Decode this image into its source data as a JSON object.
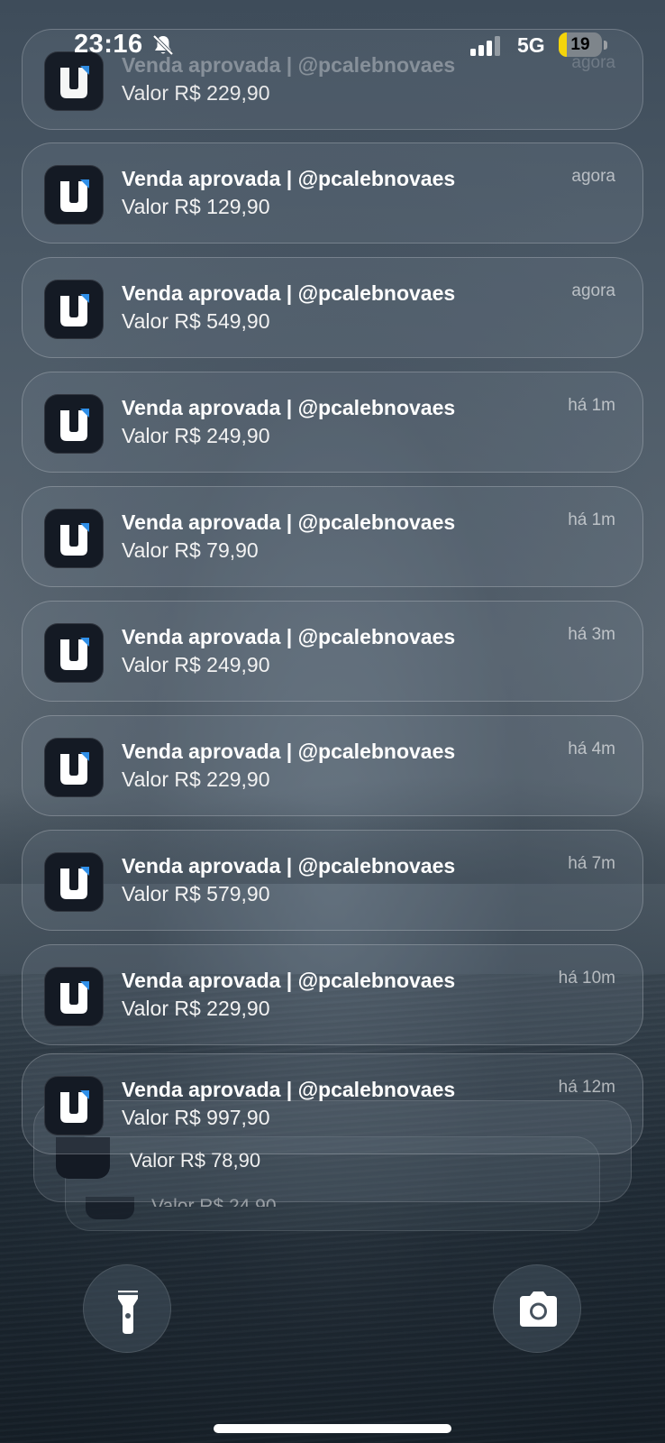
{
  "status_bar": {
    "time": "23:16",
    "silent_icon": "bell-slash-icon",
    "signal_icon": "cellular-signal-icon",
    "network": "5G",
    "battery_level": "19",
    "battery_fraction": 0.19,
    "battery_color": "#f4d40a"
  },
  "notifications": [
    {
      "title": "Venda aprovada | @pcalebnovaes",
      "body": "Valor R$ 229,90",
      "time": "agora",
      "icon": "app-logo-icon"
    },
    {
      "title": "Venda aprovada | @pcalebnovaes",
      "body": "Valor R$ 129,90",
      "time": "agora",
      "icon": "app-logo-icon"
    },
    {
      "title": "Venda aprovada | @pcalebnovaes",
      "body": "Valor R$ 549,90",
      "time": "agora",
      "icon": "app-logo-icon"
    },
    {
      "title": "Venda aprovada | @pcalebnovaes",
      "body": "Valor R$ 249,90",
      "time": "há 1m",
      "icon": "app-logo-icon"
    },
    {
      "title": "Venda aprovada | @pcalebnovaes",
      "body": "Valor R$ 79,90",
      "time": "há 1m",
      "icon": "app-logo-icon"
    },
    {
      "title": "Venda aprovada | @pcalebnovaes",
      "body": "Valor R$ 249,90",
      "time": "há 3m",
      "icon": "app-logo-icon"
    },
    {
      "title": "Venda aprovada | @pcalebnovaes",
      "body": "Valor R$ 229,90",
      "time": "há 4m",
      "icon": "app-logo-icon"
    },
    {
      "title": "Venda aprovada | @pcalebnovaes",
      "body": "Valor R$ 579,90",
      "time": "há 7m",
      "icon": "app-logo-icon"
    },
    {
      "title": "Venda aprovada | @pcalebnovaes",
      "body": "Valor R$ 229,90",
      "time": "há 10m",
      "icon": "app-logo-icon"
    },
    {
      "title": "Venda aprovada | @pcalebnovaes",
      "body": "Valor R$ 997,90",
      "time": "há 12m",
      "icon": "app-logo-icon"
    }
  ],
  "stacked": [
    {
      "body": "Valor R$ 78,90"
    },
    {
      "body": "Valor R$ 24,90"
    }
  ],
  "controls": {
    "flashlight_icon": "flashlight-icon",
    "camera_icon": "camera-icon"
  },
  "accent": {
    "logo_blue": "#2f8fe8",
    "logo_bg": "#141a24"
  }
}
